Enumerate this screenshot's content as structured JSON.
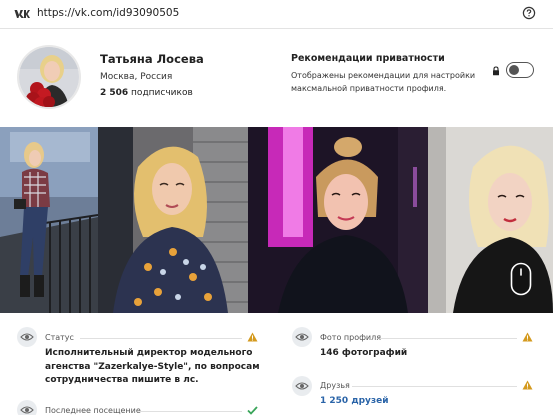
{
  "browser": {
    "url": "https://vk.com/id93090505"
  },
  "profile": {
    "name": "Татьяна Лосева",
    "city": "Москва, Россия",
    "followers_count": "2 506",
    "followers_label": " подписчиков"
  },
  "privacy": {
    "title": "Рекомендации приватности",
    "description": "Отображены рекомендации для настройки максмальной приватности профиля.",
    "toggle_on": false
  },
  "photos": [
    {
      "icon": "photo-woman-railing"
    },
    {
      "icon": "photo-woman-blonde-brick"
    },
    {
      "icon": "photo-woman-pink-light"
    },
    {
      "icon": "photo-woman-blonde-dark"
    }
  ],
  "info": {
    "status": {
      "label": "Статус",
      "lines": [
        "Исполнительный директор модельного",
        "агенства \"Zazerkalye-Style\", по вопросам",
        "сотрудничества пишите в лс."
      ],
      "flag": "warning"
    },
    "last_visit": {
      "label": "Последнее посещение",
      "flag": "ok"
    },
    "photos_profile": {
      "label": "Фото профиля",
      "value": "146 фотографий",
      "flag": "warning"
    },
    "friends": {
      "label": "Друзья",
      "value": "1 250 друзей",
      "flag": "warning"
    }
  },
  "colors": {
    "link": "#2a64a8",
    "warning": "#d49a1e",
    "ok": "#3aa55a"
  }
}
